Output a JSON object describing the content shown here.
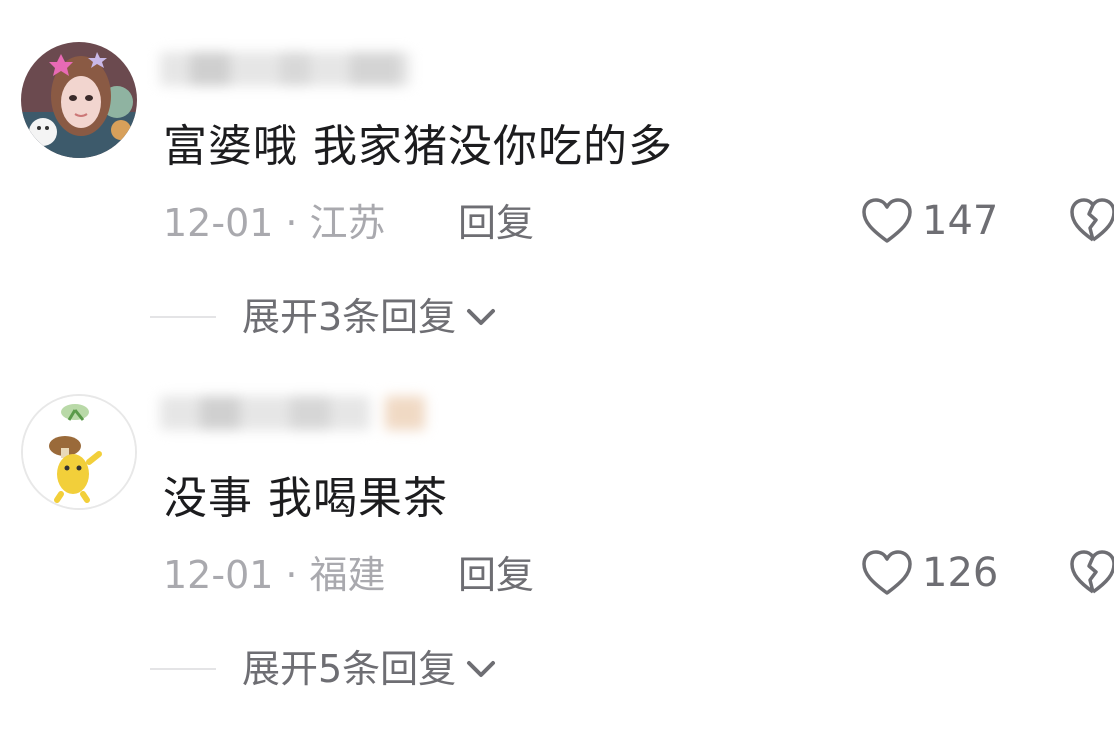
{
  "comments": [
    {
      "text": "富婆哦 我家猪没你吃的多",
      "date": "12-01",
      "separator": "·",
      "location": "江苏",
      "reply_label": "回复",
      "likes": "147",
      "expand_label": "展开3条回复"
    },
    {
      "text": "没事 我喝果茶",
      "date": "12-01",
      "separator": "·",
      "location": "福建",
      "reply_label": "回复",
      "likes": "126",
      "expand_label": "展开5条回复"
    }
  ],
  "icons": {
    "like": "heart-outline-icon",
    "dislike": "broken-heart-icon",
    "expand": "chevron-down-icon"
  },
  "colors": {
    "text_primary": "#1c1c1e",
    "text_meta": "#a9a9ae",
    "text_secondary": "#6e6e73"
  }
}
